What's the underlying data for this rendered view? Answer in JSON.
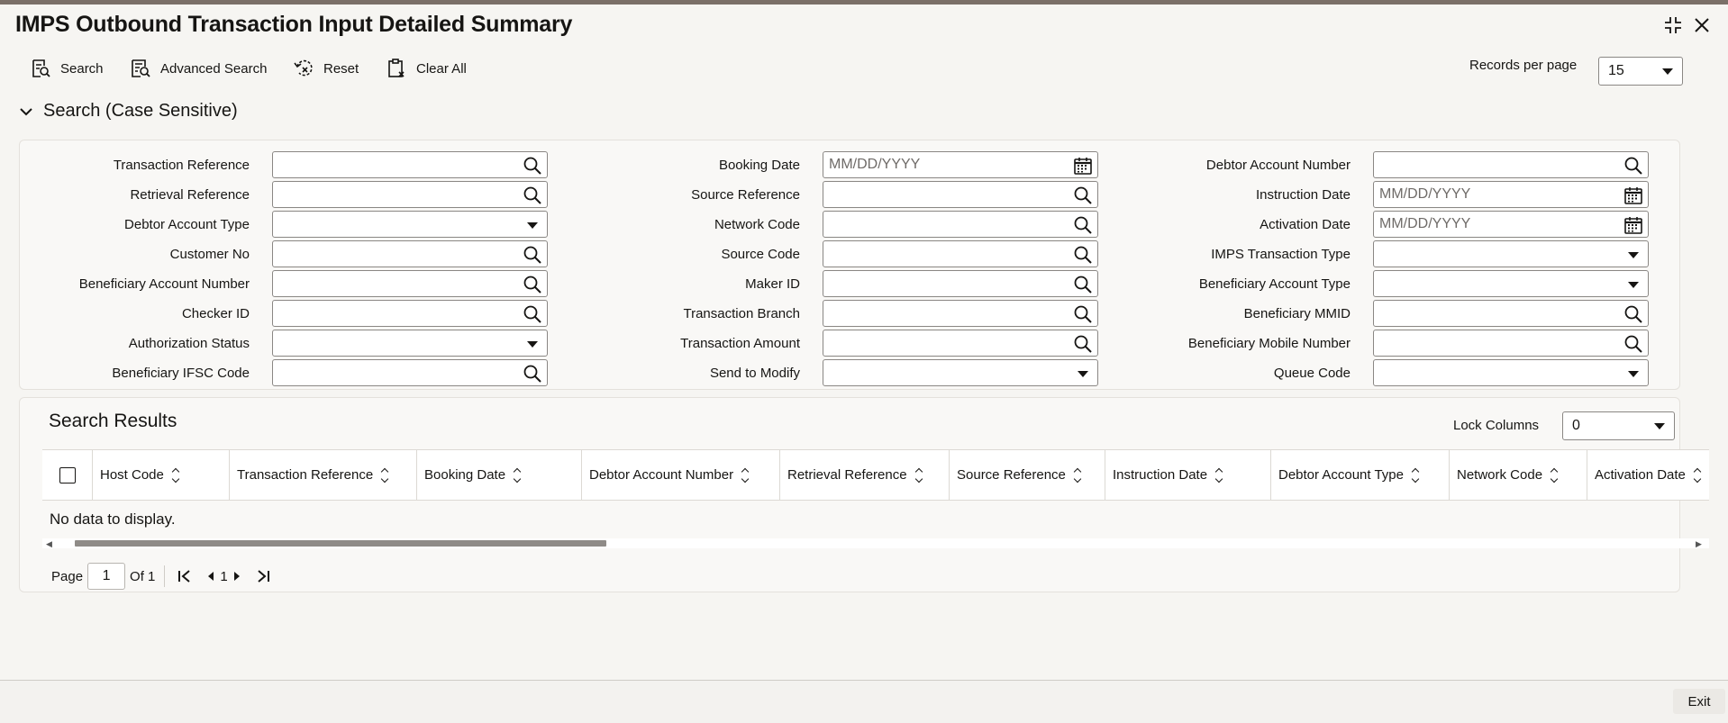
{
  "window": {
    "title": "IMPS Outbound Transaction Input Detailed Summary",
    "maximize_icon": "collapse-icon",
    "close_icon": "close-icon"
  },
  "toolbar": {
    "search_label": "Search",
    "advanced_search_label": "Advanced Search",
    "reset_label": "Reset",
    "clear_all_label": "Clear All",
    "records_per_page_label": "Records per page",
    "records_per_page_value": "15"
  },
  "search_section": {
    "title": "Search (Case Sensitive)",
    "date_placeholder": "MM/DD/YYYY",
    "col1": [
      {
        "label": "Transaction Reference",
        "kind": "lookup"
      },
      {
        "label": "Retrieval Reference",
        "kind": "lookup"
      },
      {
        "label": "Debtor Account Type",
        "kind": "select"
      },
      {
        "label": "Customer No",
        "kind": "lookup"
      },
      {
        "label": "Beneficiary Account Number",
        "kind": "lookup"
      },
      {
        "label": "Checker ID",
        "kind": "lookup"
      },
      {
        "label": "Authorization Status",
        "kind": "select"
      },
      {
        "label": "Beneficiary IFSC Code",
        "kind": "lookup"
      }
    ],
    "col2": [
      {
        "label": "Booking Date",
        "kind": "date"
      },
      {
        "label": "Source Reference",
        "kind": "lookup"
      },
      {
        "label": "Network Code",
        "kind": "lookup"
      },
      {
        "label": "Source Code",
        "kind": "lookup"
      },
      {
        "label": "Maker ID",
        "kind": "lookup"
      },
      {
        "label": "Transaction Branch",
        "kind": "lookup"
      },
      {
        "label": "Transaction Amount",
        "kind": "lookup"
      },
      {
        "label": "Send to Modify",
        "kind": "select"
      }
    ],
    "col3": [
      {
        "label": "Debtor Account Number",
        "kind": "lookup"
      },
      {
        "label": "Instruction Date",
        "kind": "date"
      },
      {
        "label": "Activation Date",
        "kind": "date"
      },
      {
        "label": "IMPS Transaction Type",
        "kind": "select"
      },
      {
        "label": "Beneficiary Account Type",
        "kind": "select"
      },
      {
        "label": "Beneficiary MMID",
        "kind": "lookup"
      },
      {
        "label": "Beneficiary Mobile Number",
        "kind": "lookup"
      },
      {
        "label": "Queue Code",
        "kind": "select"
      }
    ]
  },
  "results": {
    "title": "Search Results",
    "lock_columns_label": "Lock Columns",
    "lock_columns_value": "0",
    "columns": [
      "Host Code",
      "Transaction Reference",
      "Booking Date",
      "Debtor Account Number",
      "Retrieval Reference",
      "Source Reference",
      "Instruction Date",
      "Debtor Account Type",
      "Network Code",
      "Activation Date"
    ],
    "empty_message": "No data to display."
  },
  "pager": {
    "page_label": "Page",
    "page_value": "1",
    "of_label": "Of 1",
    "current_page": "1"
  },
  "footer": {
    "exit_label": "Exit"
  }
}
